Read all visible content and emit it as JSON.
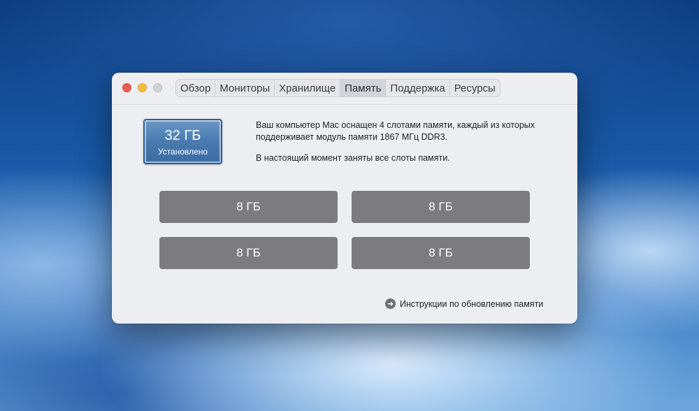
{
  "window": {
    "tabs": [
      {
        "label": "Обзор"
      },
      {
        "label": "Мониторы"
      },
      {
        "label": "Хранилище"
      },
      {
        "label": "Память"
      },
      {
        "label": "Поддержка"
      },
      {
        "label": "Ресурсы"
      }
    ],
    "active_tab": "Память"
  },
  "memory": {
    "installed_size": "32 ГБ",
    "installed_label": "Установлено",
    "description": "Ваш компьютер Mac оснащен 4 слотами памяти, каждый из которых поддерживает модуль памяти 1867 МГц DDR3.",
    "status": "В настоящий момент заняты все слоты памяти.",
    "slots": [
      {
        "label": "8 ГБ"
      },
      {
        "label": "8 ГБ"
      },
      {
        "label": "8 ГБ"
      },
      {
        "label": "8 ГБ"
      }
    ],
    "help_link": "Инструкции по обновлению памяти"
  },
  "icons": {
    "help_link_icon": "arrow-right-circle-icon"
  },
  "colors": {
    "badge": "#4b7db2",
    "slot": "#7c7c7e",
    "close": "#ee5b53",
    "minimize": "#f3be3e",
    "zoom": "#cfd1d4"
  }
}
